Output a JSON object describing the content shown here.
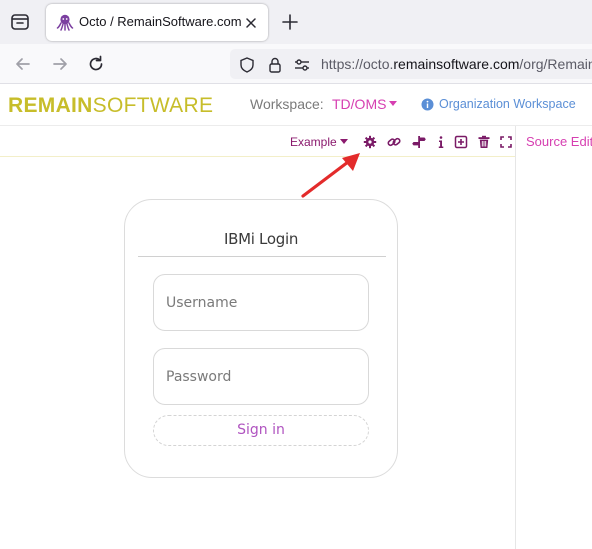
{
  "browser": {
    "tab": {
      "title": "Octo / RemainSoftware.com",
      "favicon": "octopus-icon"
    },
    "url": {
      "prefix": "https://octo.",
      "domain": "remainsoftware.com",
      "path": "/org/Remain"
    }
  },
  "header": {
    "brand_bold": "REMAIN",
    "brand_light": "SOFTWARE",
    "workspace_label": "Workspace:",
    "workspace_value": "TD/OMS",
    "org_link": "Organization Workspace",
    "brand_color": "#c7bd2a",
    "accent_color": "#d63fb1"
  },
  "toolbar": {
    "example_label": "Example",
    "icons": [
      "gear-icon",
      "link-icon",
      "signpost-icon",
      "info-icon",
      "plus-square-icon",
      "trash-icon",
      "fullscreen-icon"
    ],
    "source_edit": "Source Edit"
  },
  "login": {
    "title": "IBMi Login",
    "username_placeholder": "Username",
    "password_placeholder": "Password",
    "signin_label": "Sign in"
  }
}
